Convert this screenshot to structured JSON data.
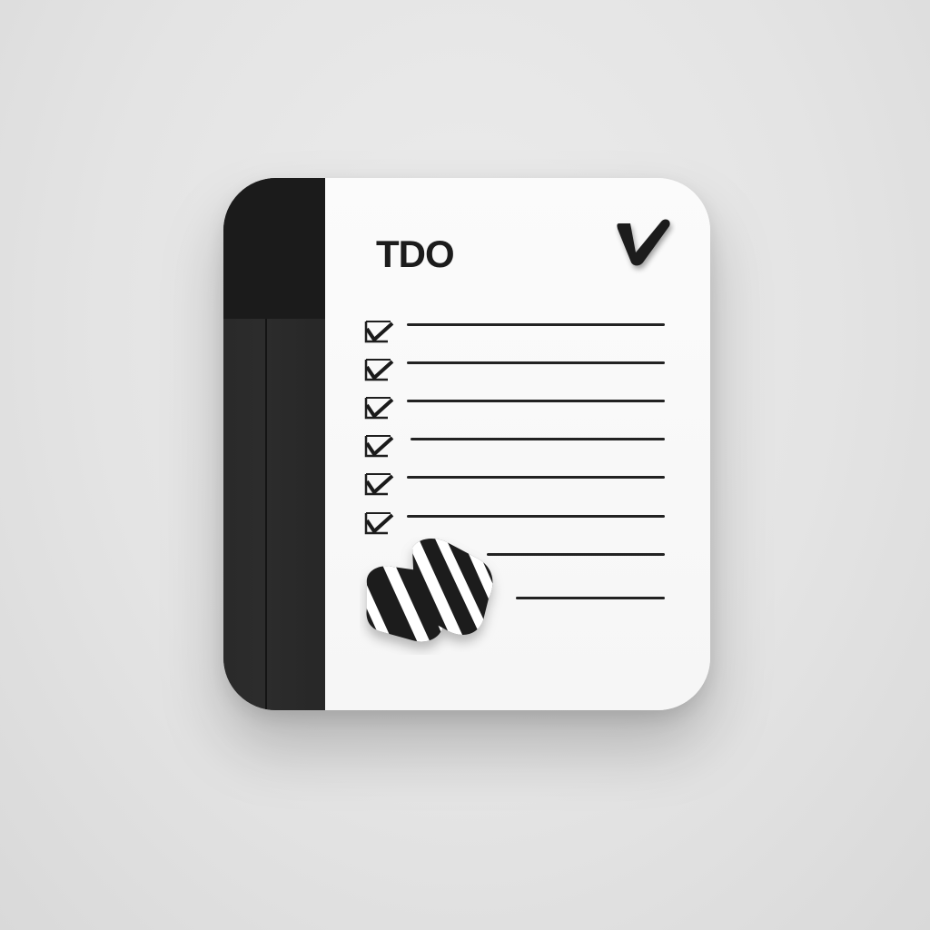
{
  "icon": {
    "title": "TDO",
    "items": [
      {
        "done": true
      },
      {
        "done": true
      },
      {
        "done": true
      },
      {
        "done": true
      },
      {
        "done": true
      },
      {
        "done": true
      },
      {
        "done": false
      },
      {
        "done": false
      }
    ]
  },
  "colors": {
    "background": "#e4e4e4",
    "spine": "#202020",
    "page": "#f9f9f9",
    "ink": "#1c1c1c"
  },
  "icons": {
    "header_check": "checkmark-icon",
    "row_check": "checkbox-checked-icon",
    "badge": "striped-eraser-icon"
  }
}
